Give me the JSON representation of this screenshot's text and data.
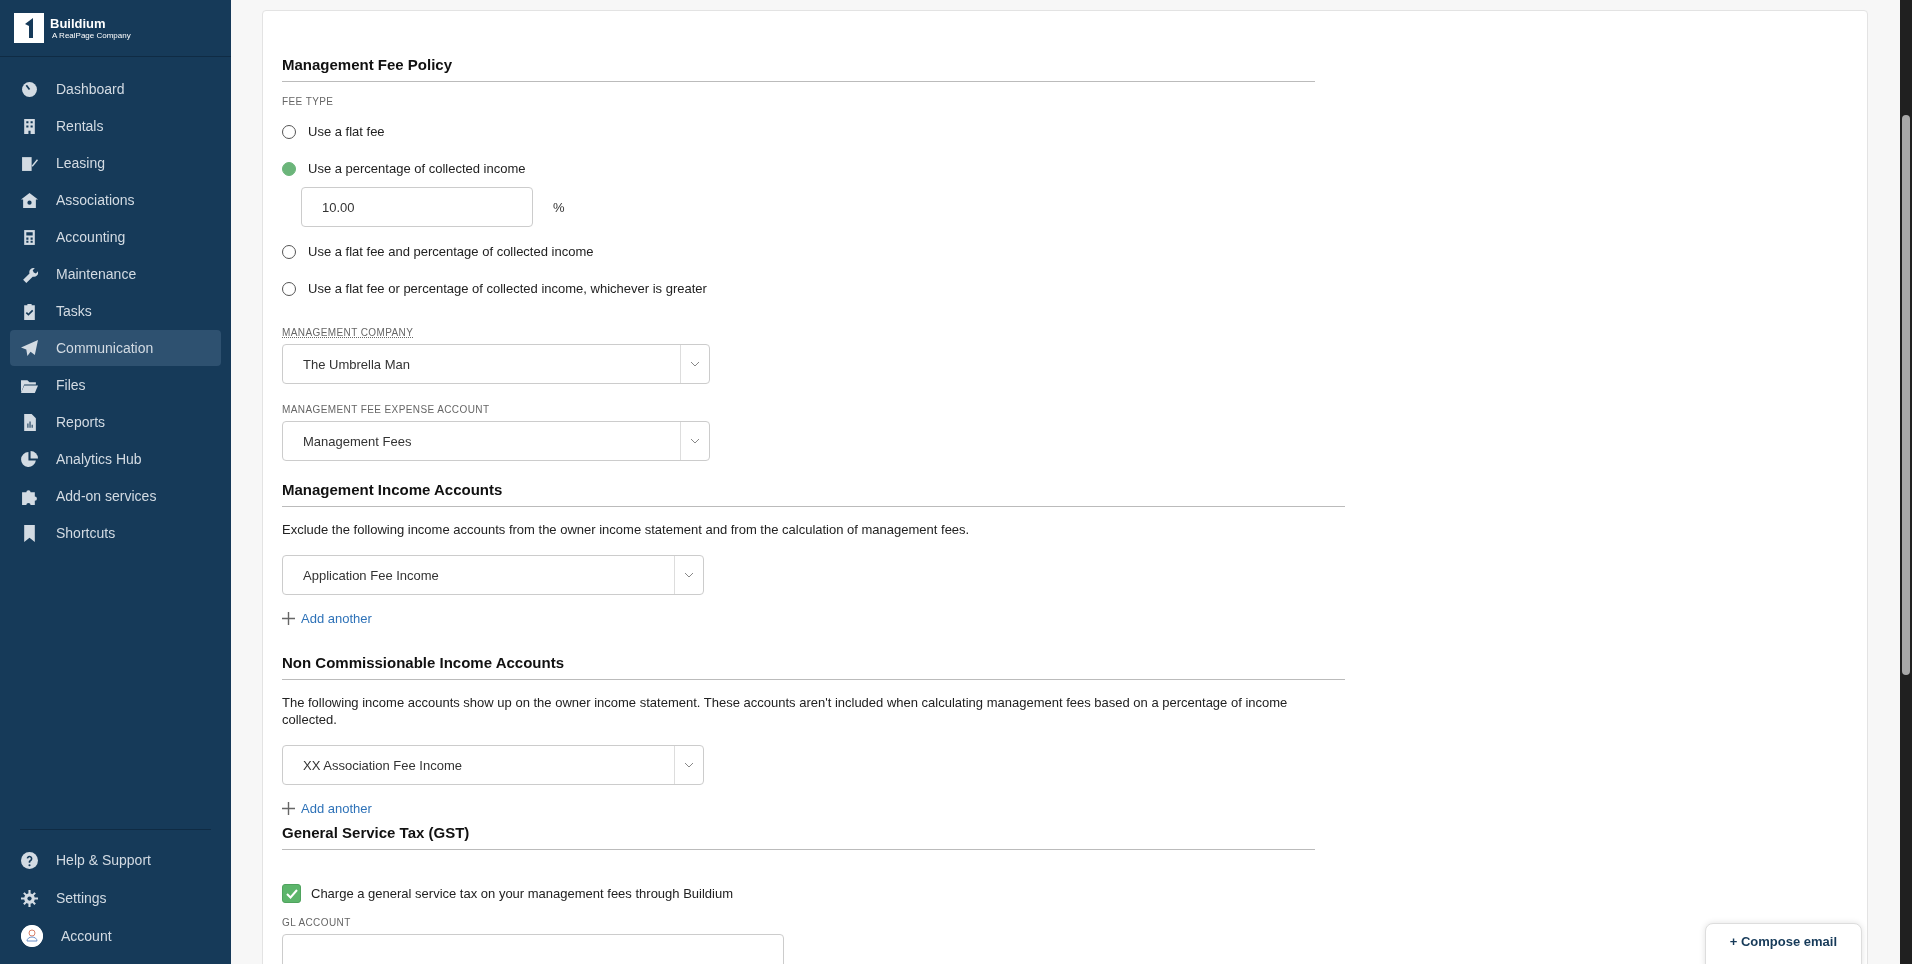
{
  "sidebar": {
    "logo": {
      "name": "Buildium",
      "tagline": "A RealPage Company"
    },
    "items": [
      {
        "label": "Dashboard",
        "selected": false
      },
      {
        "label": "Rentals",
        "selected": false
      },
      {
        "label": "Leasing",
        "selected": false
      },
      {
        "label": "Associations",
        "selected": false
      },
      {
        "label": "Accounting",
        "selected": false
      },
      {
        "label": "Maintenance",
        "selected": false
      },
      {
        "label": "Tasks",
        "selected": false
      },
      {
        "label": "Communication",
        "selected": true
      },
      {
        "label": "Files",
        "selected": false
      },
      {
        "label": "Reports",
        "selected": false
      },
      {
        "label": "Analytics Hub",
        "selected": false
      },
      {
        "label": "Add-on services",
        "selected": false
      },
      {
        "label": "Shortcuts",
        "selected": false
      }
    ],
    "footer_items": [
      {
        "label": "Help & Support"
      },
      {
        "label": "Settings"
      },
      {
        "label": "Account"
      }
    ]
  },
  "fee_policy": {
    "heading": "Management Fee Policy",
    "fee_type_label": "FEE TYPE",
    "options": [
      {
        "label": "Use a flat fee",
        "selected": false
      },
      {
        "label": "Use a percentage of collected income",
        "selected": true,
        "field": {
          "value": "10.00",
          "unit": "%"
        }
      },
      {
        "label": "Use a flat fee and percentage of collected income",
        "selected": false
      },
      {
        "label": "Use a flat fee or percentage of collected income, whichever is greater",
        "selected": false
      }
    ],
    "management_company": {
      "label": "MANAGEMENT COMPANY",
      "value": "The Umbrella Man"
    },
    "expense_account": {
      "label": "MANAGEMENT FEE EXPENSE ACCOUNT",
      "value": "Management Fees"
    }
  },
  "income_sections": [
    {
      "heading": "Management Income Accounts",
      "description": "Exclude the following income accounts from the owner income statement and from the calculation of management fees.",
      "accounts": [
        "Application Fee Income"
      ],
      "add_link": "Add another"
    },
    {
      "heading": "Non Commissionable Income Accounts",
      "description": "The following income accounts show up on the owner income statement. These accounts aren't included when calculating management fees based on a percentage of income collected.",
      "accounts": [
        "XX Association Fee Income"
      ],
      "add_link": "Add another"
    }
  ],
  "gst": {
    "heading": "General Service Tax (GST)",
    "checkbox": {
      "label": "Charge a general service tax on your management fees through Buildium",
      "checked": true
    },
    "gl_account_label": "GL ACCOUNT"
  },
  "compose_button": "+ Compose email"
}
